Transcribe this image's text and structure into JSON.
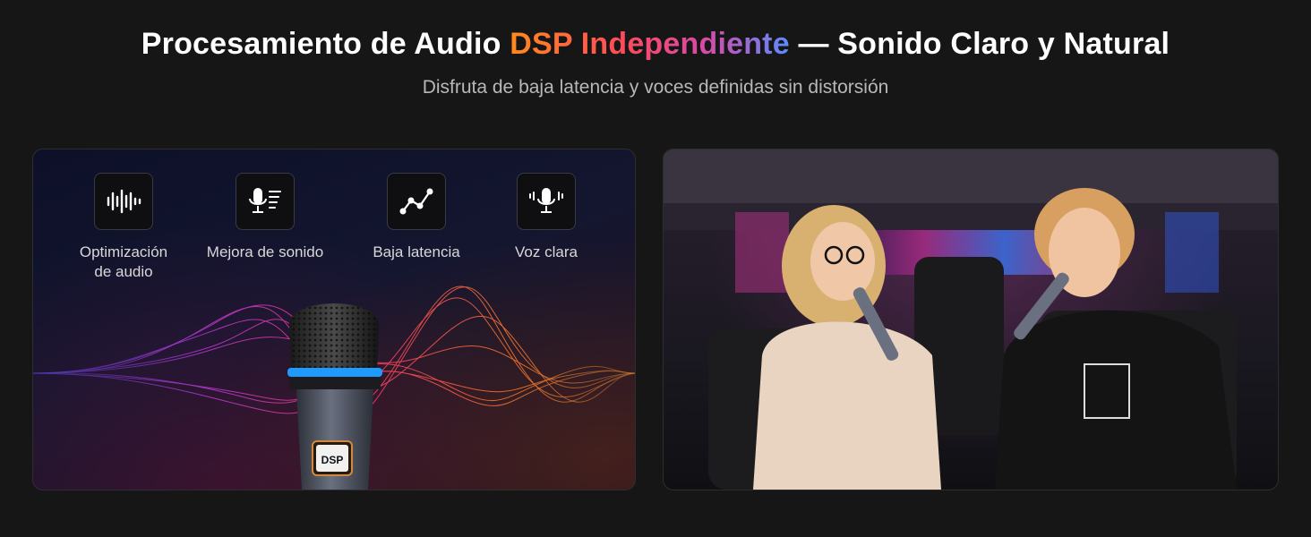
{
  "header": {
    "title_prefix": "Procesamiento de Audio ",
    "title_highlight": "DSP Independiente",
    "title_suffix": " — Sonido Claro y Natural",
    "subtitle": "Disfruta de baja latencia y voces definidas sin distorsión"
  },
  "features": [
    {
      "label_line1": "Optimización",
      "label_line2": "de audio",
      "icon": "waveform-icon"
    },
    {
      "label_line1": "Mejora de sonido",
      "label_line2": "",
      "icon": "mic-levels-icon"
    },
    {
      "label_line1": "Baja latencia",
      "label_line2": "",
      "icon": "line-graph-icon"
    },
    {
      "label_line1": "Voz clara",
      "label_line2": "",
      "icon": "mic-voice-icon"
    }
  ],
  "mic": {
    "badge": "DSP"
  },
  "colors": {
    "background": "#161616",
    "accent_orange": "#ff8a1c",
    "accent_pink": "#d64aa8",
    "accent_blue": "#5a8cff",
    "mic_ring": "#1e9bff"
  }
}
